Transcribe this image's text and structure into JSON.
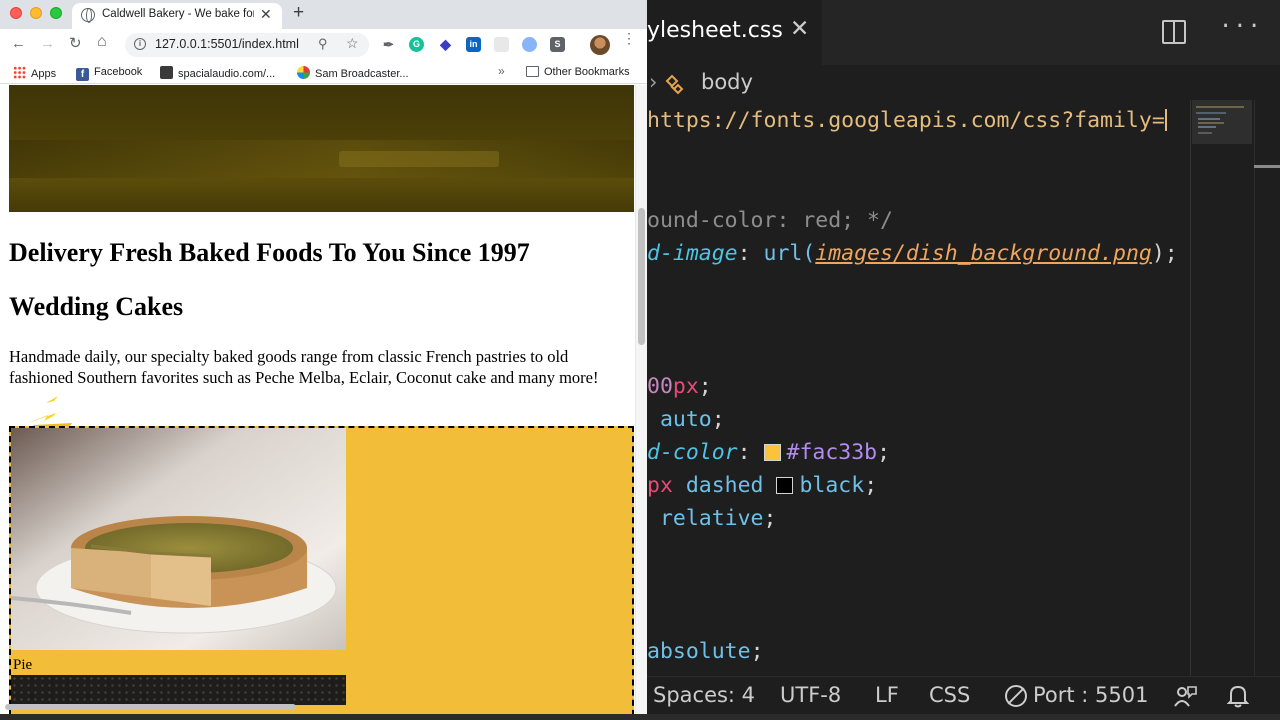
{
  "browser": {
    "tab_title": "Caldwell Bakery - We bake for",
    "tab_close": "✕",
    "new_tab": "+",
    "url": "127.0.0.1:5501/index.html",
    "bookmarks": [
      {
        "label": "Apps",
        "icon": "apps-grid-icon"
      },
      {
        "label": "Facebook",
        "icon": "facebook-icon"
      },
      {
        "label": "spacialaudio.com/...",
        "icon": "spacialaudio-icon"
      },
      {
        "label": "Sam Broadcaster...",
        "icon": "sam-broadcaster-icon"
      }
    ],
    "bookmarks_more": "»",
    "other_bookmarks": "Other Bookmarks"
  },
  "page": {
    "heading_delivery": "Delivery Fresh Baked Foods To You Since 1997",
    "heading_wedding": "Wedding Cakes",
    "intro": "Handmade daily, our specialty baked goods range from classic French pastries to old fashioned Southern favorites such as Peche Melba, Eclair, Coconut cake and many more!",
    "pie_caption": "Pie",
    "colors": {
      "feature_box": "#f2be3a",
      "hero": "#4b3f08"
    }
  },
  "editor": {
    "tab_label": "ylesheet.css",
    "tab_close": "✕",
    "more": "···",
    "breadcrumb_chevron": "›",
    "breadcrumb_body": "body",
    "lines": {
      "import_url": "https://fonts.googleapis.com/css?family=",
      "comment": "ound-color: red; */",
      "bgimage_prop": "d-image",
      "bgimage_colon": ": ",
      "bgimage_fn": "url(",
      "bgimage_path": "images/dish_background.png",
      "bgimage_end": ");",
      "width_num": "00",
      "width_unit": "px",
      "width_semi": ";",
      "margin_val": " auto",
      "margin_semi": ";",
      "bgcolor_prop": "d-color",
      "bgcolor_colon": ": ",
      "bgcolor_hex": "#fac33b",
      "bgcolor_semi": ";",
      "border_unit": "px",
      "border_style": " dashed ",
      "border_color": "black",
      "border_semi": ";",
      "position_val": " relative",
      "position_semi": ";",
      "absolute_val": "absolute",
      "absolute_semi": ";"
    },
    "swatches": {
      "bgcolor": "#fac33b",
      "border": "#000000"
    },
    "status": {
      "spaces": "Spaces: 4",
      "encoding": "UTF-8",
      "eol": "LF",
      "language": "CSS",
      "port": "Port : 5501"
    }
  }
}
